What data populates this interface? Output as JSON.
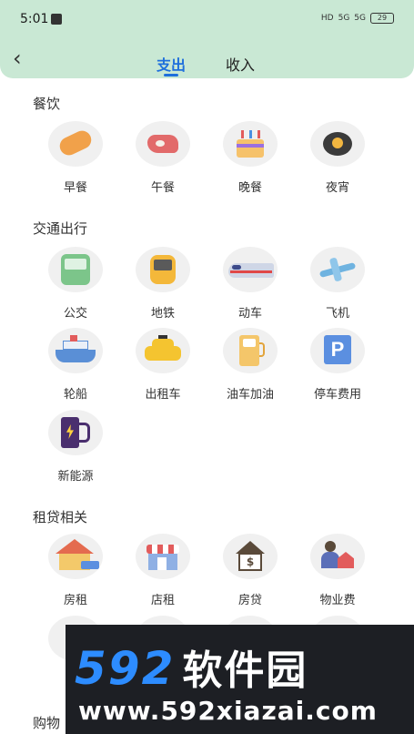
{
  "status": {
    "time": "5:01",
    "icons": [
      "HD",
      "5G",
      "5G"
    ],
    "battery": "29"
  },
  "tabs": [
    {
      "label": "支出",
      "active": true
    },
    {
      "label": "收入",
      "active": false
    }
  ],
  "sections": [
    {
      "title": "餐饮",
      "items": [
        {
          "label": "早餐",
          "icon": "bread-icon"
        },
        {
          "label": "午餐",
          "icon": "steak-icon"
        },
        {
          "label": "晚餐",
          "icon": "cake-icon"
        },
        {
          "label": "夜宵",
          "icon": "night-snack-icon"
        }
      ]
    },
    {
      "title": "交通出行",
      "items": [
        {
          "label": "公交",
          "icon": "bus-icon"
        },
        {
          "label": "地铁",
          "icon": "subway-icon"
        },
        {
          "label": "动车",
          "icon": "high-speed-train-icon"
        },
        {
          "label": "飞机",
          "icon": "airplane-icon"
        },
        {
          "label": "轮船",
          "icon": "ship-icon"
        },
        {
          "label": "出租车",
          "icon": "taxi-icon"
        },
        {
          "label": "油车加油",
          "icon": "gas-pump-icon"
        },
        {
          "label": "停车费用",
          "icon": "parking-icon"
        },
        {
          "label": "新能源",
          "icon": "ev-charging-icon"
        }
      ]
    },
    {
      "title": "租贷相关",
      "items": [
        {
          "label": "房租",
          "icon": "house-rent-icon"
        },
        {
          "label": "店租",
          "icon": "shop-icon"
        },
        {
          "label": "房贷",
          "icon": "mortgage-icon"
        },
        {
          "label": "物业费",
          "icon": "property-fee-icon"
        }
      ]
    },
    {
      "title": "购物"
    }
  ],
  "watermark": {
    "brand": "592",
    "brand_cn": "软件园",
    "url": "www.592xiazai.com"
  },
  "colors": {
    "header": "#c9e8d4",
    "accent": "#1e6fdc"
  }
}
